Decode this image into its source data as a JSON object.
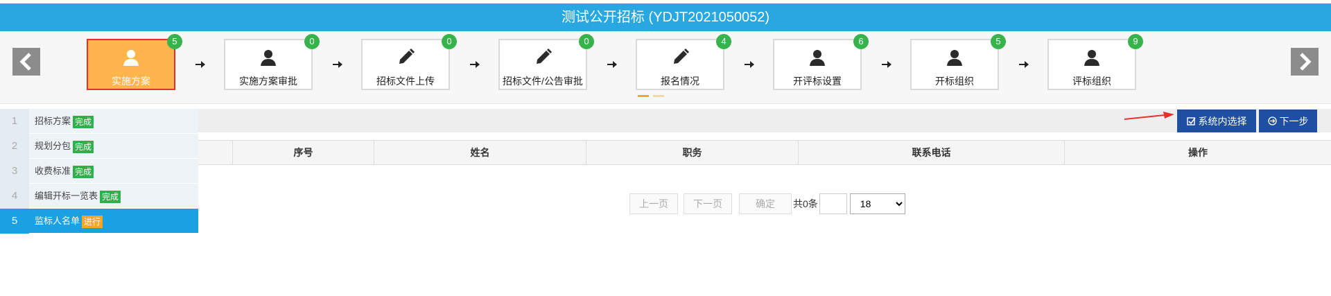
{
  "header": {
    "title": "测试公开招标 (YDJT2021050052)"
  },
  "steps": [
    {
      "label": "实施方案",
      "badge": "5",
      "icon": "user-icon"
    },
    {
      "label": "实施方案审批",
      "badge": "0",
      "icon": "user-icon"
    },
    {
      "label": "招标文件上传",
      "badge": "0",
      "icon": "pencil-icon"
    },
    {
      "label": "招标文件/公告审批",
      "badge": "0",
      "icon": "pencil-icon"
    },
    {
      "label": "报名情况",
      "badge": "4",
      "icon": "pencil-icon"
    },
    {
      "label": "开评标设置",
      "badge": "6",
      "icon": "user-icon"
    },
    {
      "label": "开标组织",
      "badge": "5",
      "icon": "user-icon"
    },
    {
      "label": "评标组织",
      "badge": "9",
      "icon": "user-icon"
    }
  ],
  "active_step": "实施方案",
  "side": {
    "items": [
      {
        "num": "1",
        "label": "招标方案",
        "status": "完成"
      },
      {
        "num": "2",
        "label": "规划分包",
        "status": "完成"
      },
      {
        "num": "3",
        "label": "收费标准",
        "status": "完成"
      },
      {
        "num": "4",
        "label": "编辑开标一览表",
        "status": "完成"
      },
      {
        "num": "5",
        "label": "监标人名单",
        "status": "进行"
      }
    ]
  },
  "toolbar": {
    "select_label": "系统内选择",
    "next_label": "下一步"
  },
  "table": {
    "columns": [
      "",
      "序号",
      "姓名",
      "职务",
      "联系电话",
      "操作"
    ]
  },
  "pager": {
    "prev": "上一页",
    "next": "下一页",
    "confirm": "确定",
    "total": "共0条",
    "page_size": "18"
  },
  "colors": {
    "header": "#29a7e1",
    "active_step": "#ffb54c",
    "badge": "#36b34a",
    "button": "#1f4fa0",
    "side_active": "#1ba0e2"
  }
}
